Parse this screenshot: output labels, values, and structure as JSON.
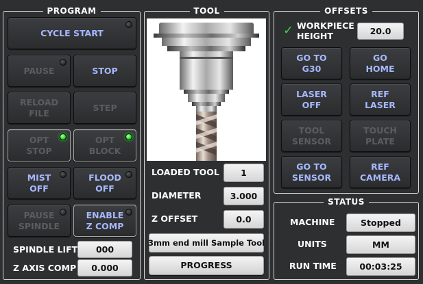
{
  "program": {
    "title": "PROGRAM",
    "cycle_start": "CYCLE START",
    "pause": "PAUSE",
    "stop": "STOP",
    "reload_file": "RELOAD\nFILE",
    "step": "STEP",
    "opt_stop": "OPT\nSTOP",
    "opt_block": "OPT\nBLOCK",
    "mist_off": "MIST\nOFF",
    "flood_off": "FLOOD\nOFF",
    "pause_spindle": "PAUSE\nSPINDLE",
    "enable_z_comp": "ENABLE\nZ COMP",
    "spindle_lift_label": "SPINDLE LIFT",
    "spindle_lift_value": "000",
    "z_axis_comp_label": "Z AXIS COMP",
    "z_axis_comp_value": "0.000"
  },
  "tool": {
    "title": "TOOL",
    "loaded_tool_label": "LOADED TOOL",
    "loaded_tool_value": "1",
    "diameter_label": "DIAMETER",
    "diameter_value": "3.000",
    "z_offset_label": "Z OFFSET",
    "z_offset_value": "0.0",
    "description": "3mm end mill Sample Tool",
    "progress": "PROGRESS"
  },
  "offsets": {
    "title": "OFFSETS",
    "workpiece_height_label": "WORKPIECE\nHEIGHT",
    "workpiece_height_value": "20.0",
    "go_to_g30": "GO TO\nG30",
    "go_home": "GO\nHOME",
    "laser_off": "LASER\nOFF",
    "ref_laser": "REF\nLASER",
    "tool_sensor": "TOOL\nSENSOR",
    "touch_plate": "TOUCH\nPLATE",
    "go_to_sensor": "GO TO\nSENSOR",
    "ref_camera": "REF\nCAMERA"
  },
  "status": {
    "title": "STATUS",
    "machine_label": "MACHINE",
    "machine_value": "Stopped",
    "units_label": "UNITS",
    "units_value": "MM",
    "run_time_label": "RUN TIME",
    "run_time_value": "00:03:25"
  },
  "colors": {
    "background": "#2e2f31",
    "button_text": "#8fa6ff",
    "disabled_text": "#5b5c5f",
    "led_on": "#25e025"
  }
}
